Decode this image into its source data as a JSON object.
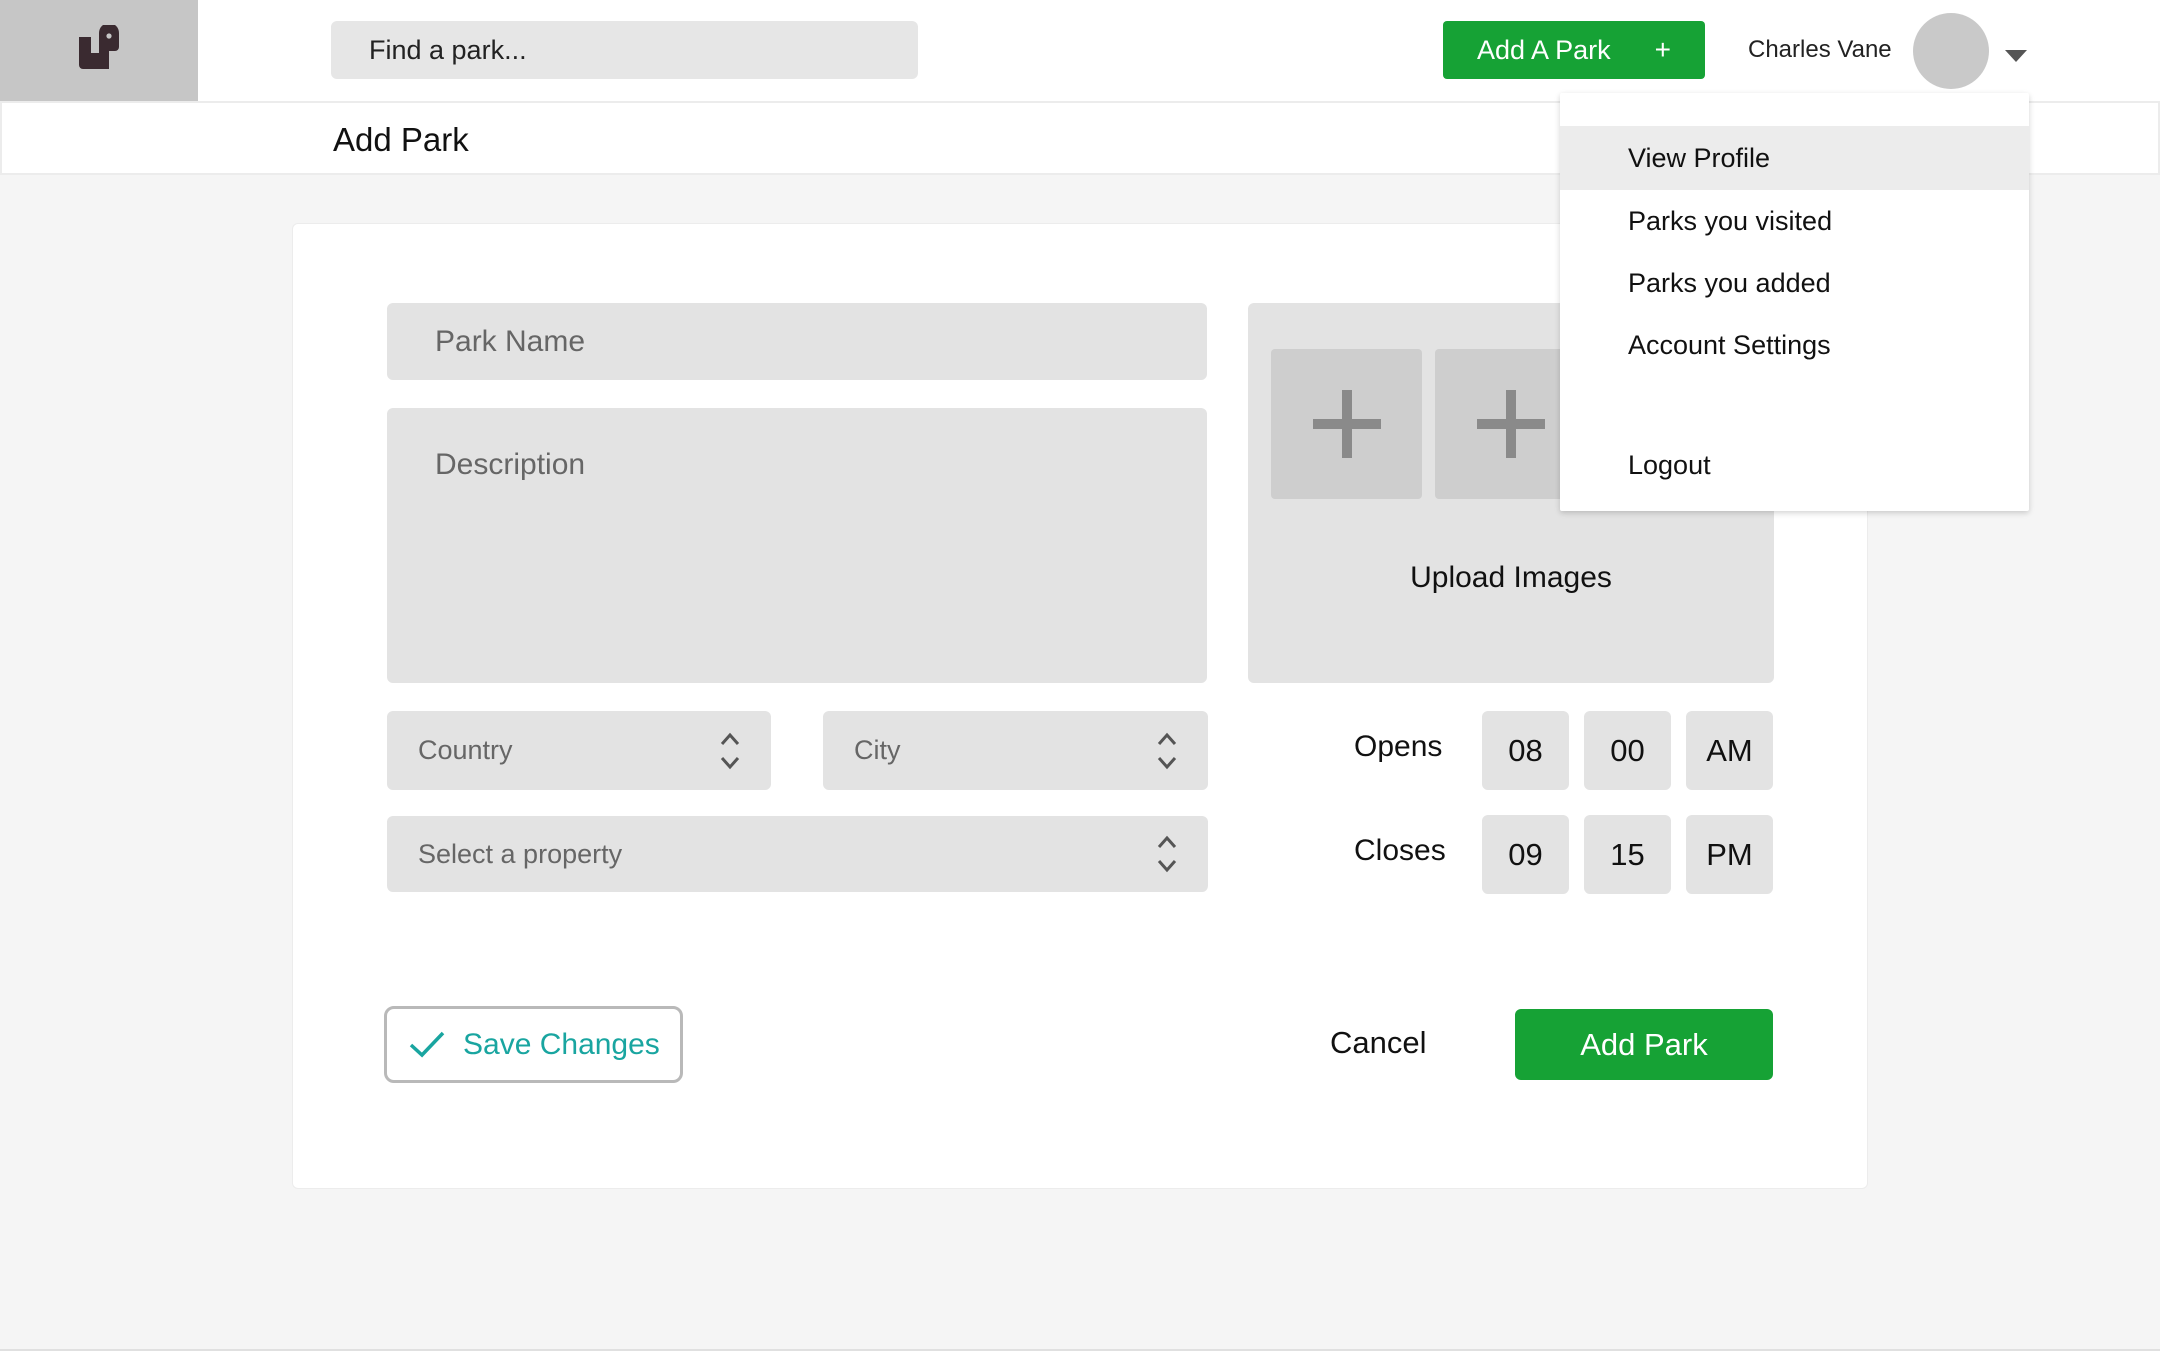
{
  "header": {
    "search_placeholder": "Find a park...",
    "add_park_label": "Add A Park",
    "add_park_plus": "+",
    "user_name": "Charles Vane"
  },
  "page": {
    "title": "Add Park"
  },
  "form": {
    "park_name_placeholder": "Park Name",
    "description_placeholder": "Description",
    "country_placeholder": "Country",
    "city_placeholder": "City",
    "property_placeholder": "Select a property",
    "upload_label": "Upload Images",
    "opens": {
      "label": "Opens",
      "hour": "08",
      "minute": "00",
      "period": "AM"
    },
    "closes": {
      "label": "Closes",
      "hour": "09",
      "minute": "15",
      "period": "PM"
    },
    "save_changes_label": "Save Changes",
    "cancel_label": "Cancel",
    "submit_label": "Add Park"
  },
  "user_menu": {
    "items": [
      {
        "label": "View Profile",
        "active": true
      },
      {
        "label": "Parks you visited"
      },
      {
        "label": "Parks you added"
      },
      {
        "label": "Account Settings"
      },
      {
        "label": "Logout"
      }
    ]
  },
  "colors": {
    "brand_green": "#16a235",
    "accent_teal": "#19a5a0",
    "field_gray": "#e3e3e3",
    "logo_bg": "#c6c6c6",
    "page_bg": "#f5f5f5"
  },
  "icons": {
    "logo": "park-logo-icon",
    "upload_slot": "plus-icon",
    "select_chevrons": "chevron-up-down-icon",
    "save_check": "check-icon",
    "user_caret": "caret-down-icon"
  }
}
